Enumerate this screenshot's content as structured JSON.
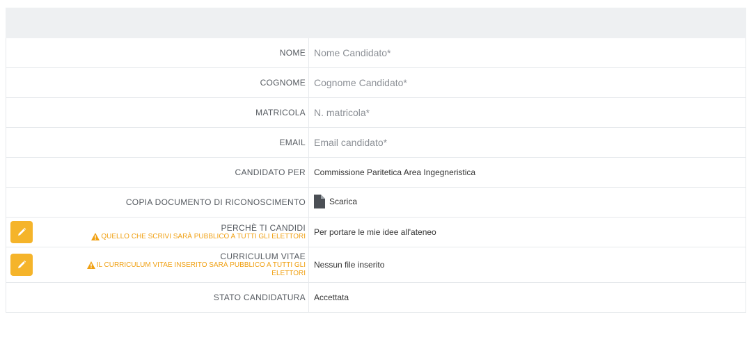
{
  "fields": {
    "nome": {
      "label": "NOME",
      "placeholder": "Nome Candidato*"
    },
    "cognome": {
      "label": "COGNOME",
      "placeholder": "Cognome Candidato*"
    },
    "matricola": {
      "label": "MATRICOLA",
      "placeholder": "N. matricola*"
    },
    "email": {
      "label": "EMAIL",
      "placeholder": "Email candidato*"
    },
    "candidato_per": {
      "label": "CANDIDATO PER",
      "value": "Commissione Paritetica Area Ingegneristica"
    },
    "documento": {
      "label": "COPIA DOCUMENTO DI RICONOSCIMENTO",
      "link": "Scarica"
    },
    "perche": {
      "label": "PERCHÈ TI CANDIDI",
      "warning": "QUELLO CHE SCRIVI SARÀ PUBBLICO A TUTTI GLI ELETTORI",
      "value": "Per portare le mie idee all'ateneo"
    },
    "curriculum": {
      "label": "CURRICULUM VITAE",
      "warning_line1": "IL CURRICULUM VITAE INSERITO SARÀ PUBBLICO A TUTTI GLI",
      "warning_line2": "ELETTORI",
      "value": "Nessun file inserito"
    },
    "stato": {
      "label": "STATO CANDIDATURA",
      "value": "Accettata"
    }
  },
  "colors": {
    "accent": "#f5b42a",
    "warning": "#f0a012",
    "success": "#1e8a2e",
    "header_bg": "#eef0f2"
  },
  "icons": {
    "edit": "pencil-icon",
    "warning": "warning-triangle-icon",
    "document": "file-icon"
  }
}
